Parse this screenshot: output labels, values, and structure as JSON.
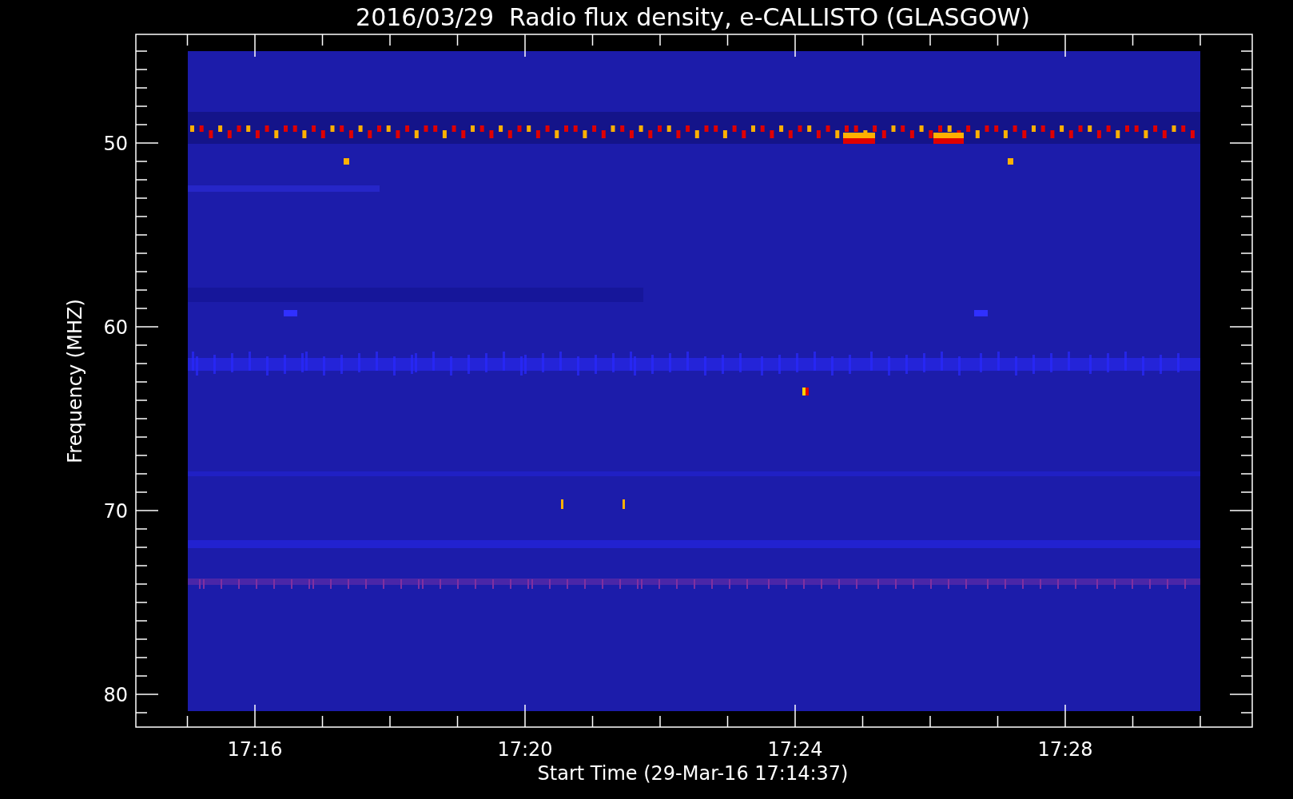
{
  "title": "2016/03/29  Radio flux density, e-CALLISTO (GLASGOW)",
  "y_axis": {
    "label": "Frequency (MHZ)",
    "ticks": [
      "50",
      "60",
      "70",
      "80"
    ]
  },
  "x_axis": {
    "label": "Start Time (29-Mar-16 17:14:37)",
    "ticks": [
      "17:16",
      "17:20",
      "17:24",
      "17:28"
    ]
  }
}
